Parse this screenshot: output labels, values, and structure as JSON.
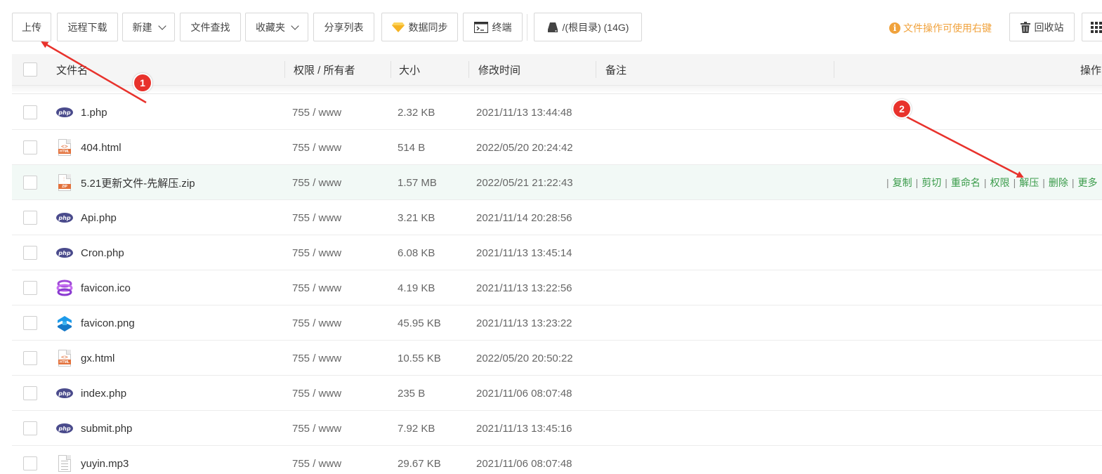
{
  "toolbar": {
    "upload": "上传",
    "remote_download": "远程下载",
    "new": "新建",
    "file_search": "文件查找",
    "favorites": "收藏夹",
    "share_list": "分享列表",
    "data_sync": "数据同步",
    "terminal": "终端",
    "path": "/(根目录) (14G)",
    "notice": "文件操作可使用右键",
    "recycle_bin": "回收站"
  },
  "columns": {
    "name": "文件名",
    "perm": "权限 / 所有者",
    "size": "大小",
    "mtime": "修改时间",
    "remark": "备注",
    "ops": "操作"
  },
  "files": [
    {
      "name": "1.php",
      "perm": "755 / www",
      "size": "2.32 KB",
      "mtime": "2021/11/13 13:44:48",
      "icon": "php-icon"
    },
    {
      "name": "404.html",
      "perm": "755 / www",
      "size": "514 B",
      "mtime": "2022/05/20 20:24:42",
      "icon": "html-file-icon"
    },
    {
      "name": "5.21更新文件-先解压.zip",
      "perm": "755 / www",
      "size": "1.57 MB",
      "mtime": "2022/05/21 21:22:43",
      "icon": "zip-file-icon"
    },
    {
      "name": "Api.php",
      "perm": "755 / www",
      "size": "3.21 KB",
      "mtime": "2021/11/14 20:28:56",
      "icon": "php-icon"
    },
    {
      "name": "Cron.php",
      "perm": "755 / www",
      "size": "6.08 KB",
      "mtime": "2021/11/13 13:45:14",
      "icon": "php-icon"
    },
    {
      "name": "favicon.ico",
      "perm": "755 / www",
      "size": "4.19 KB",
      "mtime": "2021/11/13 13:22:56",
      "icon": "ico-image-icon"
    },
    {
      "name": "favicon.png",
      "perm": "755 / www",
      "size": "45.95 KB",
      "mtime": "2021/11/13 13:23:22",
      "icon": "png-image-icon"
    },
    {
      "name": "gx.html",
      "perm": "755 / www",
      "size": "10.55 KB",
      "mtime": "2022/05/20 20:50:22",
      "icon": "html-file-icon"
    },
    {
      "name": "index.php",
      "perm": "755 / www",
      "size": "235 B",
      "mtime": "2021/11/06 08:07:48",
      "icon": "php-icon"
    },
    {
      "name": "submit.php",
      "perm": "755 / www",
      "size": "7.92 KB",
      "mtime": "2021/11/13 13:45:16",
      "icon": "php-icon"
    },
    {
      "name": "yuyin.mp3",
      "perm": "755 / www",
      "size": "29.67 KB",
      "mtime": "2021/11/06 08:07:48",
      "icon": "generic-file-icon"
    }
  ],
  "row_ops": {
    "copy": "复制",
    "cut": "剪切",
    "rename": "重命名",
    "perm": "权限",
    "extract": "解压",
    "delete": "删除",
    "more": "更多"
  },
  "annotations": {
    "badge1": "1",
    "badge2": "2"
  },
  "colors": {
    "accent_green": "#3a9b4a",
    "notice_orange": "#f0a23c",
    "annotation_red": "#e8322c",
    "highlight_row": "#f2f9f6"
  }
}
